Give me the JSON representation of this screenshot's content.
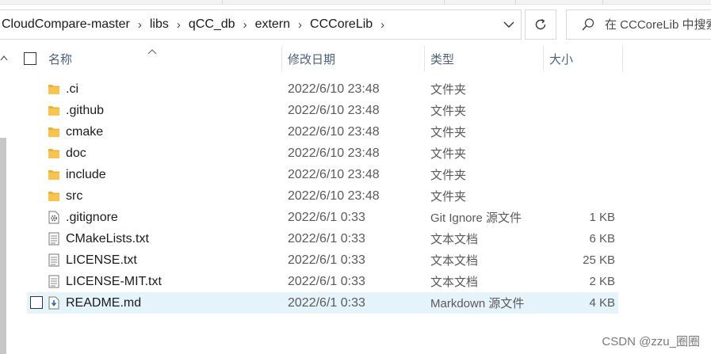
{
  "breadcrumb": [
    {
      "label": "CloudCompare-master"
    },
    {
      "label": "libs"
    },
    {
      "label": "qCC_db"
    },
    {
      "label": "extern"
    },
    {
      "label": "CCCoreLib"
    }
  ],
  "search": {
    "placeholder": "在 CCCoreLib 中搜索"
  },
  "columns": {
    "name": "名称",
    "modified": "修改日期",
    "type": "类型",
    "size": "大小"
  },
  "files": [
    {
      "name": ".ci",
      "modified": "2022/6/10 23:48",
      "type": "文件夹",
      "size": "",
      "icon": "folder-icon"
    },
    {
      "name": ".github",
      "modified": "2022/6/10 23:48",
      "type": "文件夹",
      "size": "",
      "icon": "folder-icon"
    },
    {
      "name": "cmake",
      "modified": "2022/6/10 23:48",
      "type": "文件夹",
      "size": "",
      "icon": "folder-icon"
    },
    {
      "name": "doc",
      "modified": "2022/6/10 23:48",
      "type": "文件夹",
      "size": "",
      "icon": "folder-icon"
    },
    {
      "name": "include",
      "modified": "2022/6/10 23:48",
      "type": "文件夹",
      "size": "",
      "icon": "folder-icon"
    },
    {
      "name": "src",
      "modified": "2022/6/10 23:48",
      "type": "文件夹",
      "size": "",
      "icon": "folder-icon"
    },
    {
      "name": ".gitignore",
      "modified": "2022/6/1 0:33",
      "type": "Git Ignore 源文件",
      "size": "1 KB",
      "icon": "gear-file-icon"
    },
    {
      "name": "CMakeLists.txt",
      "modified": "2022/6/1 0:33",
      "type": "文本文档",
      "size": "6 KB",
      "icon": "text-file-icon"
    },
    {
      "name": "LICENSE.txt",
      "modified": "2022/6/1 0:33",
      "type": "文本文档",
      "size": "25 KB",
      "icon": "text-file-icon"
    },
    {
      "name": "LICENSE-MIT.txt",
      "modified": "2022/6/1 0:33",
      "type": "文本文档",
      "size": "2 KB",
      "icon": "text-file-icon"
    },
    {
      "name": "README.md",
      "modified": "2022/6/1 0:33",
      "type": "Markdown 源文件",
      "size": "4 KB",
      "icon": "markdown-file-icon",
      "hovered": true
    }
  ],
  "watermark": "CSDN @zzu_圈圈",
  "colors": {
    "selection": "#e5f3fb",
    "folder": "#f8c44f",
    "header_text": "#4c607a"
  }
}
